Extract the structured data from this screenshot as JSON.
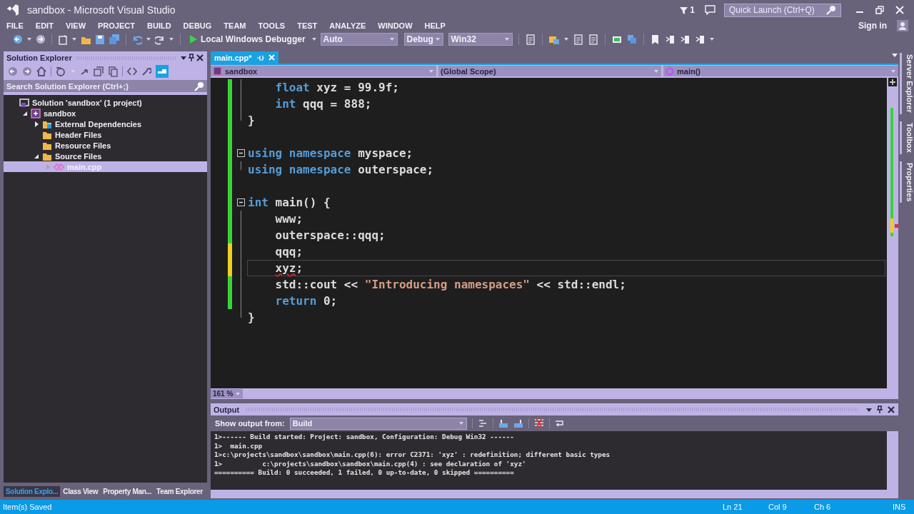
{
  "window": {
    "title": "sandbox - Microsoft Visual Studio",
    "notification_count": "1",
    "quick_launch_placeholder": "Quick Launch (Ctrl+Q)",
    "sign_in": "Sign in"
  },
  "menu": [
    "FILE",
    "EDIT",
    "VIEW",
    "PROJECT",
    "BUILD",
    "DEBUG",
    "TEAM",
    "TOOLS",
    "TEST",
    "ANALYZE",
    "WINDOW",
    "HELP"
  ],
  "toolbar": {
    "debugger": "Local Windows Debugger",
    "solution_config": "Auto",
    "configuration": "Debug",
    "platform": "Win32"
  },
  "solution_explorer": {
    "title": "Solution Explorer",
    "search_placeholder": "Search Solution Explorer (Ctrl+;)",
    "tree": [
      {
        "label": "Solution 'sandbox' (1 project)",
        "kind": "solution",
        "selected": false,
        "children": [
          {
            "label": "sandbox",
            "kind": "project",
            "expanded": true,
            "selected": false,
            "children": [
              {
                "label": "External Dependencies",
                "kind": "dependencies",
                "expanded": false,
                "selected": false
              },
              {
                "label": "Header Files",
                "kind": "folder",
                "selected": false
              },
              {
                "label": "Resource Files",
                "kind": "folder",
                "selected": false
              },
              {
                "label": "Source Files",
                "kind": "folder",
                "expanded": true,
                "selected": false,
                "children": [
                  {
                    "label": "main.cpp",
                    "kind": "cpp",
                    "expanded": false,
                    "selected": true
                  }
                ]
              }
            ]
          }
        ]
      }
    ]
  },
  "bottom_tabs": [
    {
      "label": "Solution Explo...",
      "selected": true
    },
    {
      "label": "Class View",
      "selected": false
    },
    {
      "label": "Property Man...",
      "selected": false
    },
    {
      "label": "Team Explorer",
      "selected": false
    }
  ],
  "editor": {
    "tabs": [
      {
        "label": "main.cpp*",
        "selected": true
      }
    ],
    "project": "sandbox",
    "scope": "(Global Scope)",
    "member": "main()",
    "zoom": "161 %",
    "lines": [
      {
        "kind": "region",
        "lines": [
          {
            "kind": "line",
            "toggle": false,
            "indented": true,
            "changed": true,
            "saved": true,
            "selected": false,
            "tokens": [
              {
                "kind": "keyword",
                "text": "float"
              },
              {
                "kind": "plain",
                "text": " xyz = 99.9f;"
              }
            ]
          },
          {
            "kind": "line",
            "toggle": false,
            "indented": true,
            "changed": true,
            "saved": true,
            "selected": false,
            "tokens": [
              {
                "kind": "keyword",
                "text": "int"
              },
              {
                "kind": "plain",
                "text": " qqq = 888;"
              }
            ]
          },
          {
            "kind": "line",
            "toggle": false,
            "indented": false,
            "changed": true,
            "saved": true,
            "selected": false,
            "tokens": [
              {
                "kind": "plain",
                "text": "}"
              }
            ]
          }
        ]
      },
      {
        "kind": "line",
        "toggle": false,
        "changed": true,
        "saved": true,
        "selected": false
      },
      {
        "kind": "line",
        "toggle": true,
        "indented": false,
        "changed": true,
        "saved": true,
        "selected": false,
        "tokens": [
          {
            "kind": "keyword",
            "text": "using"
          },
          {
            "kind": "keyword",
            "text": " namespace"
          },
          {
            "kind": "plain",
            "text": " myspace;"
          }
        ]
      },
      {
        "kind": "region",
        "lines": [
          {
            "kind": "line",
            "toggle": false,
            "indented": false,
            "changed": true,
            "saved": true,
            "selected": false,
            "tokens": [
              {
                "kind": "keyword",
                "text": "using"
              },
              {
                "kind": "keyword",
                "text": " namespace"
              },
              {
                "kind": "plain",
                "text": " outerspace;"
              }
            ]
          }
        ]
      },
      {
        "kind": "line",
        "toggle": false,
        "changed": true,
        "saved": true,
        "selected": false
      },
      {
        "kind": "line",
        "toggle": true,
        "indented": false,
        "changed": true,
        "saved": true,
        "selected": false,
        "tokens": [
          {
            "kind": "keyword",
            "text": "int"
          },
          {
            "kind": "plain",
            "text": " main() {"
          }
        ]
      },
      {
        "kind": "region",
        "lines": [
          {
            "kind": "line",
            "toggle": false,
            "indented": true,
            "changed": true,
            "saved": true,
            "selected": false,
            "tokens": [
              {
                "kind": "plain",
                "text": "www;"
              }
            ]
          },
          {
            "kind": "line",
            "toggle": false,
            "indented": true,
            "changed": true,
            "saved": true,
            "selected": false,
            "tokens": [
              {
                "kind": "plain",
                "text": "outerspace::qqq;"
              }
            ]
          },
          {
            "kind": "line",
            "toggle": false,
            "indented": true,
            "changed": true,
            "saved": false,
            "selected": false,
            "tokens": [
              {
                "kind": "plain",
                "text": "qqq;"
              }
            ]
          },
          {
            "kind": "line",
            "toggle": false,
            "indented": true,
            "changed": true,
            "saved": false,
            "selected": true,
            "tokens": [
              {
                "kind": "error",
                "text": "xyz"
              },
              {
                "kind": "plain",
                "text": ";"
              }
            ]
          },
          {
            "kind": "line",
            "toggle": false,
            "indented": true,
            "changed": true,
            "saved": true,
            "selected": false,
            "tokens": [
              {
                "kind": "plain",
                "text": "std::cout << "
              },
              {
                "kind": "string",
                "text": "\"Introducing namespaces\""
              },
              {
                "kind": "plain",
                "text": " << std::endl;"
              }
            ]
          },
          {
            "kind": "line",
            "toggle": false,
            "indented": true,
            "changed": true,
            "saved": true,
            "selected": false,
            "tokens": [
              {
                "kind": "keyword",
                "text": "return"
              },
              {
                "kind": "plain",
                "text": " 0;"
              }
            ]
          },
          {
            "kind": "line",
            "toggle": false,
            "indented": false,
            "changed": false,
            "selected": false,
            "tokens": [
              {
                "kind": "plain",
                "text": "}"
              }
            ]
          }
        ]
      }
    ]
  },
  "output": {
    "title": "Output",
    "source_label": "Show output from:",
    "source": "Build",
    "lines": [
      "1>------ Build started: Project: sandbox, Configuration: Debug Win32 ------",
      "1>  main.cpp",
      "1>c:\\projects\\sandbox\\sandbox\\main.cpp(6): error C2371: 'xyz' : redefinition; different basic types",
      "1>          c:\\projects\\sandbox\\sandbox\\main.cpp(4) : see declaration of 'xyz'",
      "========== Build: 0 succeeded, 1 failed, 0 up-to-date, 0 skipped =========="
    ]
  },
  "side_tabs": [
    "Server Explorer",
    "Toolbox",
    "Properties"
  ],
  "status_bar": {
    "message": "Item(s) Saved",
    "line": "Ln 21",
    "column": "Col 9",
    "char": "Ch 6",
    "mode": "INS"
  }
}
